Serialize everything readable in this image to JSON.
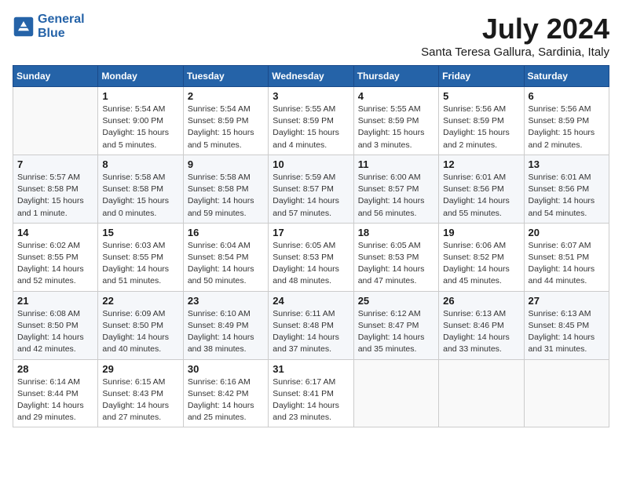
{
  "logo": {
    "line1": "General",
    "line2": "Blue"
  },
  "title": "July 2024",
  "location": "Santa Teresa Gallura, Sardinia, Italy",
  "days_of_week": [
    "Sunday",
    "Monday",
    "Tuesday",
    "Wednesday",
    "Thursday",
    "Friday",
    "Saturday"
  ],
  "weeks": [
    [
      {
        "num": "",
        "info": ""
      },
      {
        "num": "1",
        "info": "Sunrise: 5:54 AM\nSunset: 9:00 PM\nDaylight: 15 hours\nand 5 minutes."
      },
      {
        "num": "2",
        "info": "Sunrise: 5:54 AM\nSunset: 8:59 PM\nDaylight: 15 hours\nand 5 minutes."
      },
      {
        "num": "3",
        "info": "Sunrise: 5:55 AM\nSunset: 8:59 PM\nDaylight: 15 hours\nand 4 minutes."
      },
      {
        "num": "4",
        "info": "Sunrise: 5:55 AM\nSunset: 8:59 PM\nDaylight: 15 hours\nand 3 minutes."
      },
      {
        "num": "5",
        "info": "Sunrise: 5:56 AM\nSunset: 8:59 PM\nDaylight: 15 hours\nand 2 minutes."
      },
      {
        "num": "6",
        "info": "Sunrise: 5:56 AM\nSunset: 8:59 PM\nDaylight: 15 hours\nand 2 minutes."
      }
    ],
    [
      {
        "num": "7",
        "info": "Sunrise: 5:57 AM\nSunset: 8:58 PM\nDaylight: 15 hours\nand 1 minute."
      },
      {
        "num": "8",
        "info": "Sunrise: 5:58 AM\nSunset: 8:58 PM\nDaylight: 15 hours\nand 0 minutes."
      },
      {
        "num": "9",
        "info": "Sunrise: 5:58 AM\nSunset: 8:58 PM\nDaylight: 14 hours\nand 59 minutes."
      },
      {
        "num": "10",
        "info": "Sunrise: 5:59 AM\nSunset: 8:57 PM\nDaylight: 14 hours\nand 57 minutes."
      },
      {
        "num": "11",
        "info": "Sunrise: 6:00 AM\nSunset: 8:57 PM\nDaylight: 14 hours\nand 56 minutes."
      },
      {
        "num": "12",
        "info": "Sunrise: 6:01 AM\nSunset: 8:56 PM\nDaylight: 14 hours\nand 55 minutes."
      },
      {
        "num": "13",
        "info": "Sunrise: 6:01 AM\nSunset: 8:56 PM\nDaylight: 14 hours\nand 54 minutes."
      }
    ],
    [
      {
        "num": "14",
        "info": "Sunrise: 6:02 AM\nSunset: 8:55 PM\nDaylight: 14 hours\nand 52 minutes."
      },
      {
        "num": "15",
        "info": "Sunrise: 6:03 AM\nSunset: 8:55 PM\nDaylight: 14 hours\nand 51 minutes."
      },
      {
        "num": "16",
        "info": "Sunrise: 6:04 AM\nSunset: 8:54 PM\nDaylight: 14 hours\nand 50 minutes."
      },
      {
        "num": "17",
        "info": "Sunrise: 6:05 AM\nSunset: 8:53 PM\nDaylight: 14 hours\nand 48 minutes."
      },
      {
        "num": "18",
        "info": "Sunrise: 6:05 AM\nSunset: 8:53 PM\nDaylight: 14 hours\nand 47 minutes."
      },
      {
        "num": "19",
        "info": "Sunrise: 6:06 AM\nSunset: 8:52 PM\nDaylight: 14 hours\nand 45 minutes."
      },
      {
        "num": "20",
        "info": "Sunrise: 6:07 AM\nSunset: 8:51 PM\nDaylight: 14 hours\nand 44 minutes."
      }
    ],
    [
      {
        "num": "21",
        "info": "Sunrise: 6:08 AM\nSunset: 8:50 PM\nDaylight: 14 hours\nand 42 minutes."
      },
      {
        "num": "22",
        "info": "Sunrise: 6:09 AM\nSunset: 8:50 PM\nDaylight: 14 hours\nand 40 minutes."
      },
      {
        "num": "23",
        "info": "Sunrise: 6:10 AM\nSunset: 8:49 PM\nDaylight: 14 hours\nand 38 minutes."
      },
      {
        "num": "24",
        "info": "Sunrise: 6:11 AM\nSunset: 8:48 PM\nDaylight: 14 hours\nand 37 minutes."
      },
      {
        "num": "25",
        "info": "Sunrise: 6:12 AM\nSunset: 8:47 PM\nDaylight: 14 hours\nand 35 minutes."
      },
      {
        "num": "26",
        "info": "Sunrise: 6:13 AM\nSunset: 8:46 PM\nDaylight: 14 hours\nand 33 minutes."
      },
      {
        "num": "27",
        "info": "Sunrise: 6:13 AM\nSunset: 8:45 PM\nDaylight: 14 hours\nand 31 minutes."
      }
    ],
    [
      {
        "num": "28",
        "info": "Sunrise: 6:14 AM\nSunset: 8:44 PM\nDaylight: 14 hours\nand 29 minutes."
      },
      {
        "num": "29",
        "info": "Sunrise: 6:15 AM\nSunset: 8:43 PM\nDaylight: 14 hours\nand 27 minutes."
      },
      {
        "num": "30",
        "info": "Sunrise: 6:16 AM\nSunset: 8:42 PM\nDaylight: 14 hours\nand 25 minutes."
      },
      {
        "num": "31",
        "info": "Sunrise: 6:17 AM\nSunset: 8:41 PM\nDaylight: 14 hours\nand 23 minutes."
      },
      {
        "num": "",
        "info": ""
      },
      {
        "num": "",
        "info": ""
      },
      {
        "num": "",
        "info": ""
      }
    ]
  ]
}
